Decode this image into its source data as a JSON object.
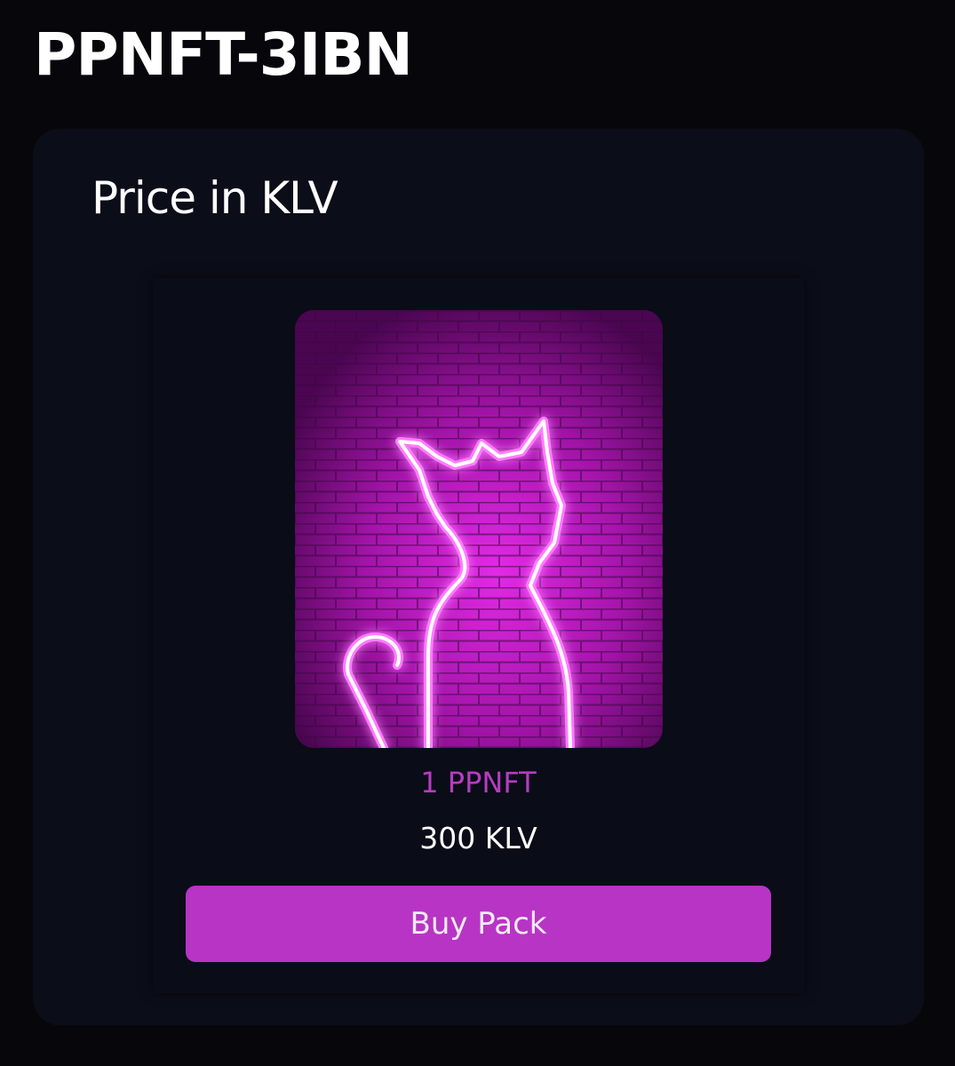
{
  "page": {
    "title": "PPNFT-3IBN"
  },
  "card": {
    "heading": "Price in KLV"
  },
  "pack": {
    "image_icon": "neon-cat-icon",
    "quantity": "1 PPNFT",
    "price": "300 KLV",
    "buy_label": "Buy Pack"
  },
  "colors": {
    "background": "#07070b",
    "card": "#0b0d19",
    "accent": "#b834c5",
    "quantity_text": "#b63cc1"
  }
}
